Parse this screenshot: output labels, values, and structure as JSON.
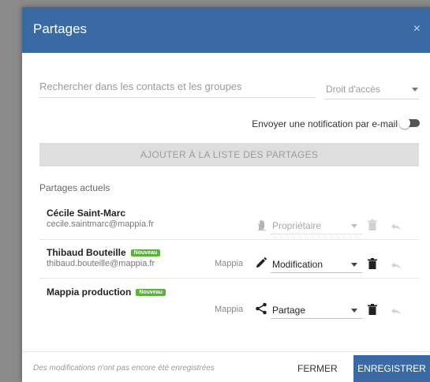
{
  "dialog": {
    "title": "Partages",
    "close_glyph": "×"
  },
  "search": {
    "placeholder": "Rechercher dans les contacts et les groupes",
    "value": ""
  },
  "access": {
    "label": "Droit d'accès"
  },
  "notification": {
    "label": "Envoyer une notification par e-mail",
    "enabled": false
  },
  "add_button": {
    "label": "AJOUTER À LA LISTE DES PARTAGES"
  },
  "current_shares": {
    "title": "Partages actuels",
    "rows": [
      {
        "name": "Cécile Saint-Marc",
        "email": "cecile.saintmarc@mappia.fr",
        "badge": "",
        "org": "",
        "role": "Propriétaire",
        "role_icon": "hand-icon",
        "disabled": true
      },
      {
        "name": "Thibaud Bouteille",
        "email": "thibaud.bouteille@mappia.fr",
        "badge": "Nouveau",
        "org": "Mappia",
        "role": "Modification",
        "role_icon": "pencil-icon",
        "disabled": false
      },
      {
        "name": "Mappia production",
        "email": "",
        "badge": "Nouveau",
        "org": "Mappia",
        "role": "Partage",
        "role_icon": "share-icon",
        "disabled": false
      }
    ]
  },
  "footer": {
    "unsaved_text": "Des modifications n'ont pas encore été enregistrées",
    "close_label": "FERMER",
    "save_label": "ENREGISTRER"
  },
  "colors": {
    "primary": "#3a6aa3",
    "badge": "#5cb13a"
  }
}
